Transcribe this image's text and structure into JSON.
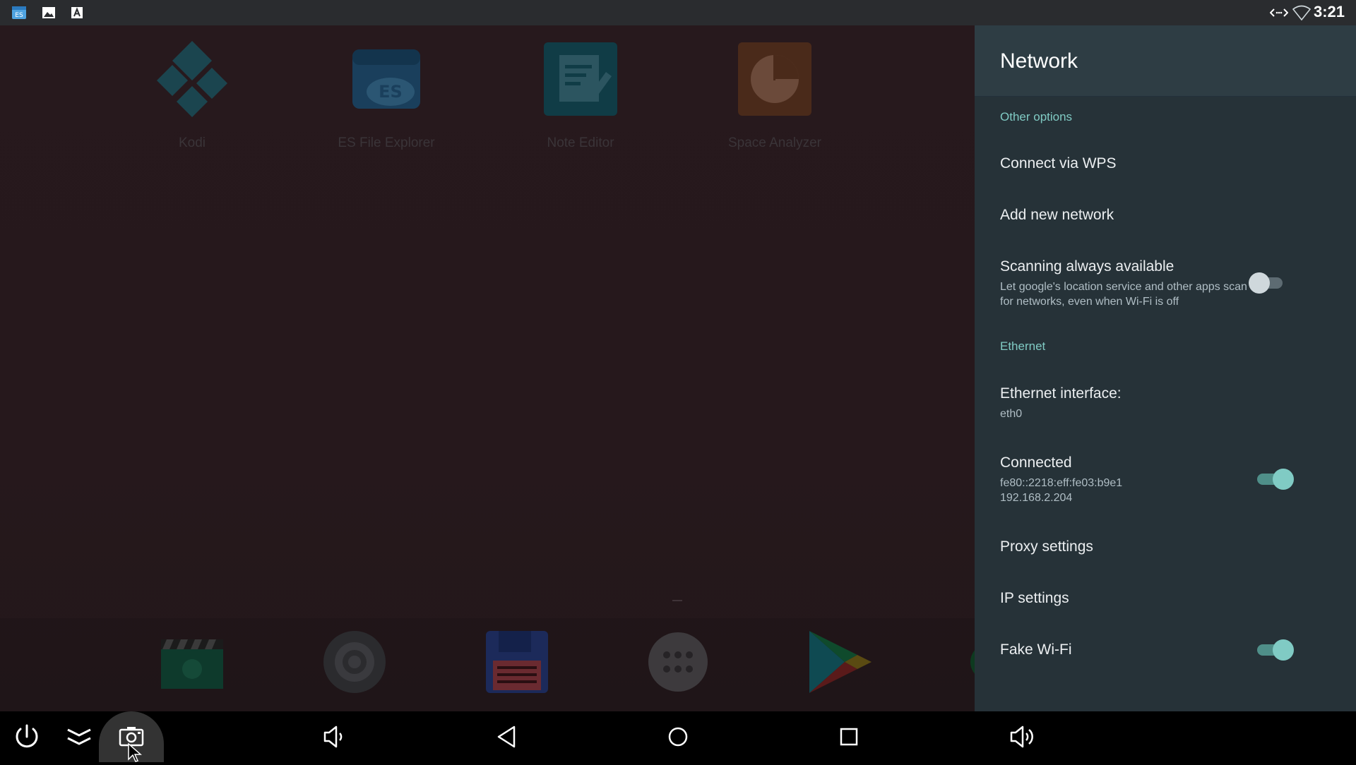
{
  "status_bar": {
    "time": "3:21",
    "left_icons": [
      "es-file-notification-icon",
      "image-notification-icon",
      "text-notification-icon"
    ],
    "right_icons": [
      "ethernet-icon",
      "wifi-icon"
    ]
  },
  "desktop": {
    "apps": [
      {
        "label": "Kodi",
        "icon": "kodi-icon"
      },
      {
        "label": "ES File Explorer",
        "icon": "es-file-explorer-icon"
      },
      {
        "label": "Note Editor",
        "icon": "note-editor-icon"
      },
      {
        "label": "Space Analyzer",
        "icon": "space-analyzer-icon"
      }
    ],
    "dock": [
      "video-clapper-icon",
      "camera-icon",
      "floppy-save-icon",
      "app-drawer-icon",
      "play-store-icon"
    ]
  },
  "panel": {
    "title": "Network",
    "sections": {
      "other_options": "Other options",
      "ethernet": "Ethernet"
    },
    "items": {
      "wps": "Connect via WPS",
      "add_network": "Add new network",
      "scanning_title": "Scanning always available",
      "scanning_sub_1": "Let google's location service and other apps scan",
      "scanning_sub_2": "for networks, even when Wi-Fi is off",
      "eth_iface_title": "Ethernet interface:",
      "eth_iface_value": "eth0",
      "connected_title": "Connected",
      "connected_ipv6": "fe80::2218:eff:fe03:b9e1",
      "connected_ipv4": "192.168.2.204",
      "proxy": "Proxy settings",
      "ip_settings": "IP settings",
      "fake_wifi": "Fake Wi-Fi"
    },
    "toggles": {
      "scanning": false,
      "connected": true,
      "fake_wifi": true
    }
  },
  "nav_bar": [
    "power-icon",
    "collapse-icon",
    "screenshot-icon",
    "volume-down-icon",
    "back-icon",
    "home-icon",
    "recents-icon",
    "volume-up-icon"
  ],
  "colors": {
    "accent": "#80cbc4",
    "panel_bg": "#263238"
  }
}
